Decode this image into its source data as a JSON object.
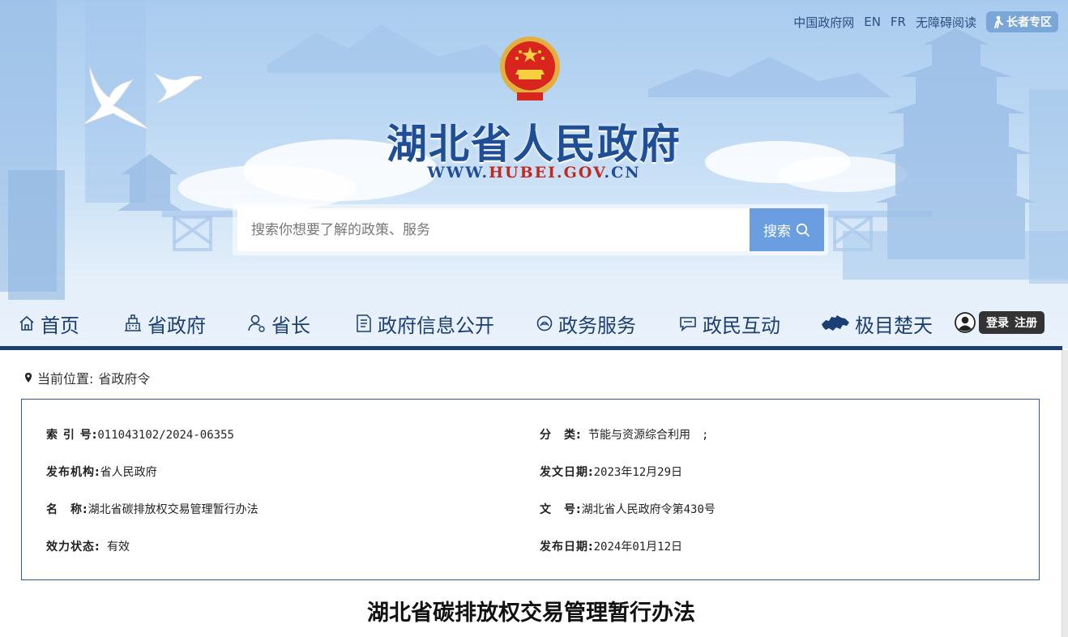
{
  "header": {
    "top_links": [
      "中国政府网",
      "EN",
      "FR",
      "无障碍阅读"
    ],
    "elder_mode_label": "长者专区",
    "site_title": "湖北省人民政府",
    "site_url_prefix": "WWW.",
    "site_url_domain": "HUBEI.GOV",
    "site_url_suffix": ".CN"
  },
  "search": {
    "placeholder": "搜索你想要了解的政策、服务",
    "button_label": "搜索"
  },
  "nav": {
    "items": [
      {
        "label": "首页",
        "icon": "home-icon"
      },
      {
        "label": "省政府",
        "icon": "building-icon"
      },
      {
        "label": "省长",
        "icon": "person-icon"
      },
      {
        "label": "政府信息公开",
        "icon": "document-icon"
      },
      {
        "label": "政务服务",
        "icon": "service-icon"
      },
      {
        "label": "政民互动",
        "icon": "chat-icon"
      },
      {
        "label": "极目楚天",
        "icon": "hubei-map-icon"
      }
    ],
    "login_label": "登录",
    "register_label": "注册"
  },
  "breadcrumb": {
    "prefix": "当前位置:",
    "current": "省政府令"
  },
  "meta": {
    "index_no_label": "索 引 号:",
    "index_no": "011043102/2024-06355",
    "category_label": "分　类:",
    "category": "节能与资源综合利用　;",
    "issuer_label": "发布机构:",
    "issuer": "省人民政府",
    "issue_date_label": "发文日期:",
    "issue_date": "2023年12月29日",
    "name_label": "名　称:",
    "name": "湖北省碳排放权交易管理暂行办法",
    "doc_no_label": "文　号:",
    "doc_no": "湖北省人民政府令第430号",
    "status_label": "效力状态:",
    "status": "有效",
    "publish_date_label": "发布日期:",
    "publish_date": "2024年01月12日"
  },
  "document": {
    "title": "湖北省碳排放权交易管理暂行办法"
  },
  "colors": {
    "nav_text": "#1c3f73",
    "title_blue": "#1f4e96",
    "url_red": "#c22a1f",
    "search_button": "#6a9ee0",
    "meta_border": "#2c5a95"
  }
}
